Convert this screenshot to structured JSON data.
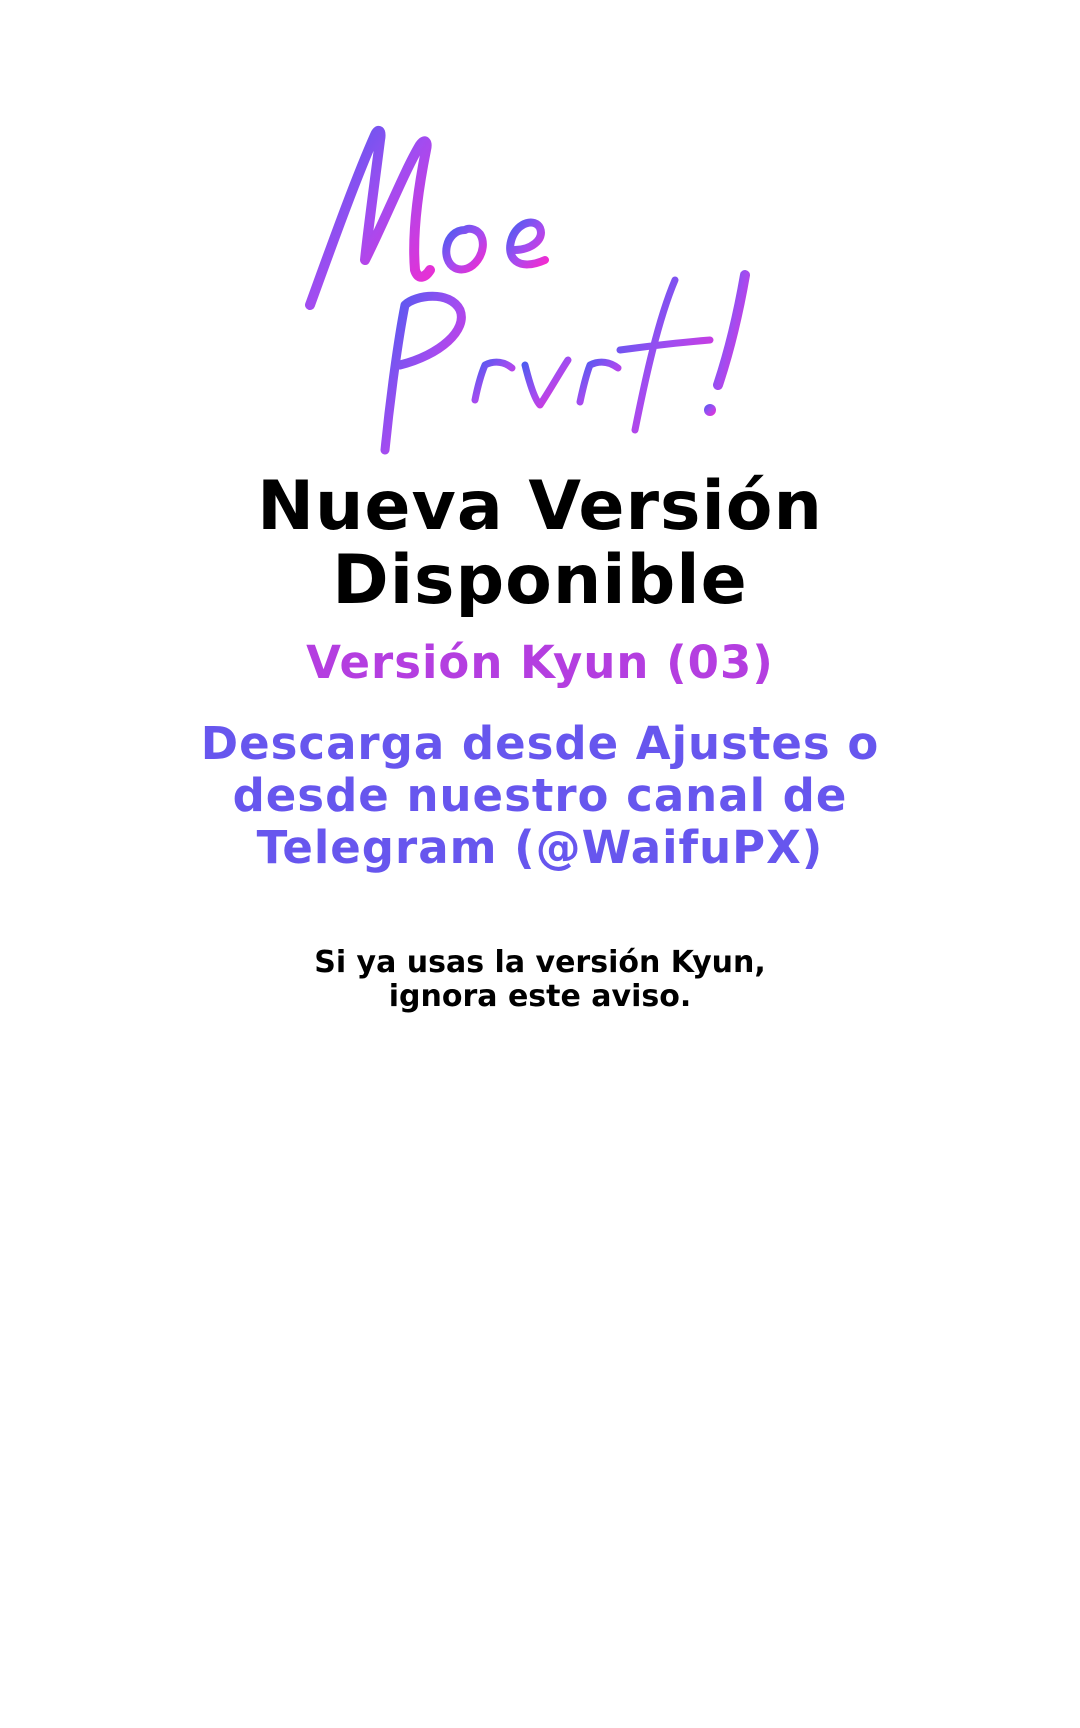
{
  "logo": {
    "text_line1": "Moe",
    "text_line2": "Prvrt!",
    "gradient_start": "#4a5cf0",
    "gradient_mid": "#a24cf0",
    "gradient_end": "#f32bd0"
  },
  "announcement": {
    "title_line1": "Nueva Versión",
    "title_line2": "Disponible",
    "version_label": "Versión Kyun (03)",
    "download_line1": "Descarga desde Ajustes o",
    "download_line2": "desde nuestro canal de",
    "download_line3": "Telegram (@WaifuPX)",
    "notice_line1": "Si ya usas la versión Kyun,",
    "notice_line2": "ignora este aviso."
  },
  "colors": {
    "background": "#ffffff",
    "title": "#000000",
    "version": "#b43ee0",
    "download": "#6756ee",
    "notice": "#000000"
  }
}
